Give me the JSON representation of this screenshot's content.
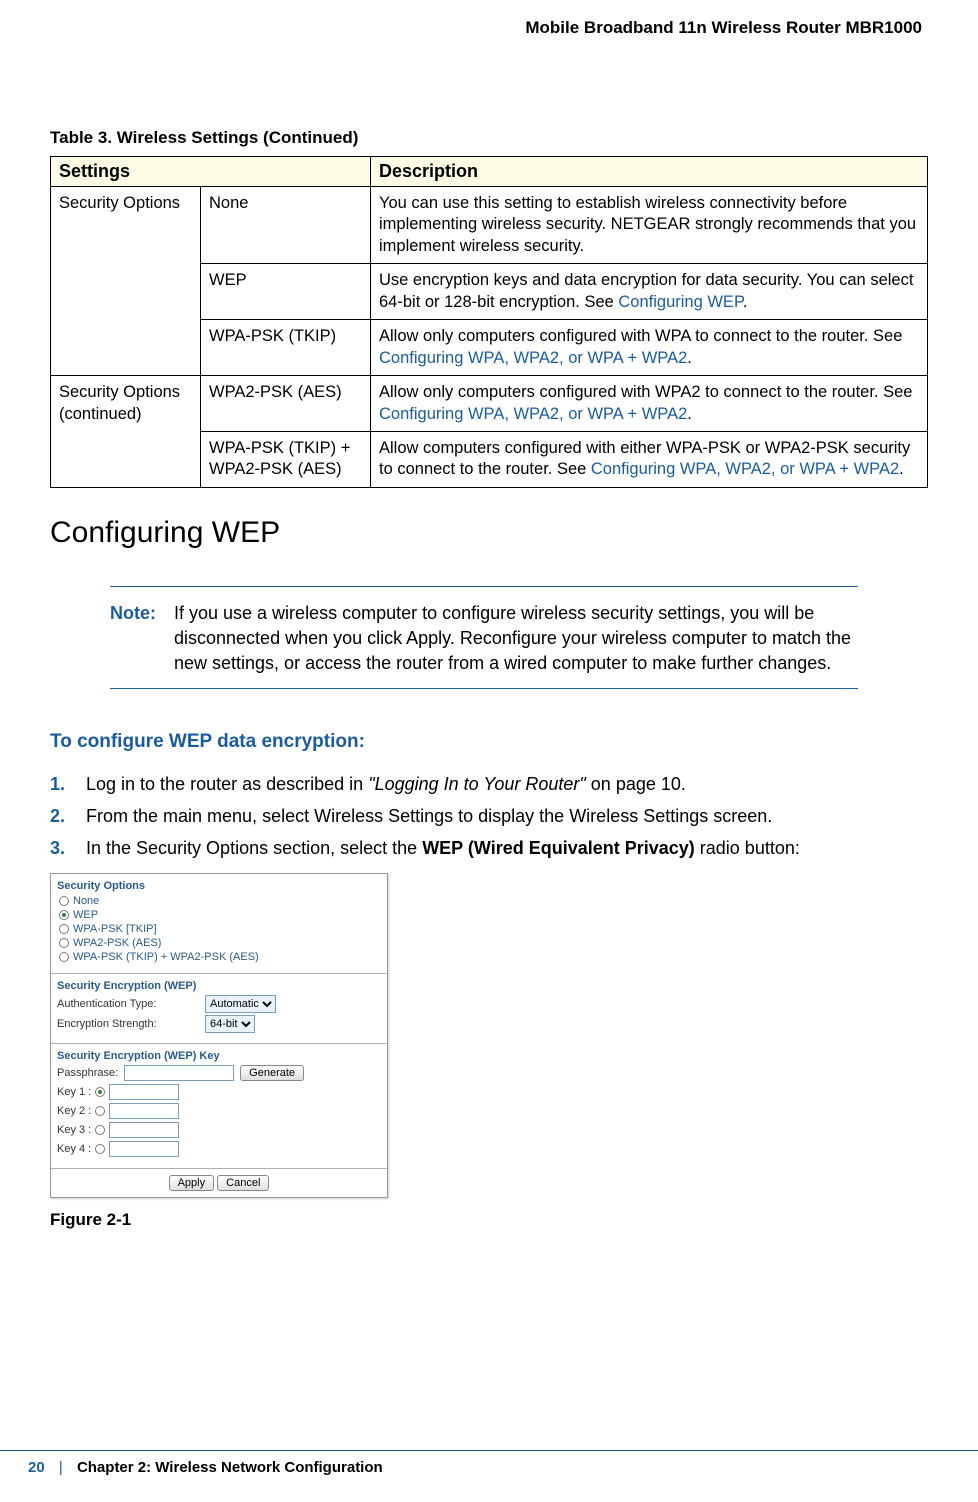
{
  "header": {
    "product": "Mobile Broadband 11n Wireless Router MBR1000"
  },
  "table": {
    "caption": "Table 3.  Wireless Settings (Continued)",
    "head": {
      "c1": "Settings",
      "c2": "Description"
    },
    "rows": {
      "r1": {
        "group": "Security Options",
        "setting": "None",
        "desc": "You can use this setting to establish wireless connectivity before implementing wireless security. NETGEAR strongly recommends that you implement wireless security."
      },
      "r2": {
        "setting": "WEP",
        "desc_a": "Use encryption keys and data encryption for data security. You can select 64-bit or 128-bit encryption. See ",
        "link": "Configuring WEP",
        "desc_b": "."
      },
      "r3": {
        "setting": "WPA-PSK (TKIP)",
        "desc_a": "Allow only computers configured with WPA to connect to the router. See ",
        "link": "Configuring WPA, WPA2, or WPA + WPA2",
        "desc_b": "."
      },
      "r4": {
        "group": "Security Options (continued)",
        "setting": "WPA2-PSK (AES)",
        "desc_a": "Allow only computers configured with WPA2 to connect to the router. See ",
        "link": "Configuring WPA, WPA2, or WPA + WPA2",
        "desc_b": "."
      },
      "r5": {
        "setting": "WPA-PSK (TKIP) + WPA2-PSK (AES)",
        "desc_a": "Allow computers configured with either WPA-PSK or WPA2-PSK security to connect to the router. See ",
        "link": "Configuring WPA, WPA2, or WPA + WPA2",
        "desc_b": "."
      }
    }
  },
  "section": {
    "title": "Configuring WEP"
  },
  "note": {
    "label": "Note:",
    "text": "If you use a wireless computer to configure wireless security settings, you will be disconnected when you click Apply. Reconfigure your wireless computer to match the new settings, or access the router from a wired computer to make further changes."
  },
  "procedure": {
    "title": "To configure WEP data encryption:",
    "steps": {
      "s1_a": "Log in to the router as described in ",
      "s1_ref": "\"Logging In to Your Router\"",
      "s1_b": " on page 10.",
      "s2": "From the main menu, select Wireless Settings to display the Wireless Settings screen.",
      "s3_a": "In the Security Options section, select the ",
      "s3_bold": "WEP (Wired Equivalent Privacy)",
      "s3_b": " radio button:"
    }
  },
  "figure": {
    "so_title": "Security Options",
    "opts": {
      "none": "None",
      "wep": "WEP",
      "wpa": "WPA-PSK [TKIP]",
      "wpa2": "WPA2-PSK (AES)",
      "mixed": "WPA-PSK (TKIP) + WPA2-PSK (AES)"
    },
    "enc_title": "Security Encryption (WEP)",
    "auth_label": "Authentication Type:",
    "auth_value": "Automatic",
    "strength_label": "Encryption Strength:",
    "strength_value": "64-bit",
    "key_title": "Security Encryption (WEP) Key",
    "passphrase": "Passphrase:",
    "generate": "Generate",
    "k1": "Key 1 :",
    "k2": "Key 2 :",
    "k3": "Key 3 :",
    "k4": "Key 4 :",
    "apply": "Apply",
    "cancel": "Cancel",
    "caption": "Figure 2-1"
  },
  "footer": {
    "page": "20",
    "sep": "|",
    "chapter": "Chapter 2:  Wireless Network Configuration"
  }
}
